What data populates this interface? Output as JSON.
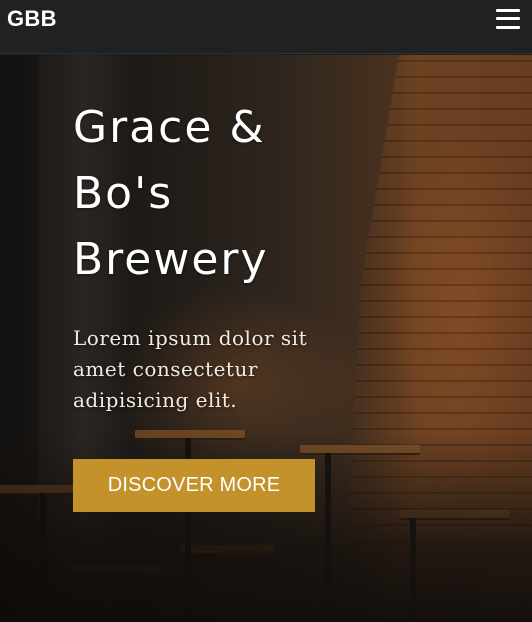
{
  "navbar": {
    "brand": "GBB",
    "menu_icon": "hamburger-menu-icon"
  },
  "hero": {
    "title_lines": [
      "Grace &",
      "Bo's",
      "Brewery"
    ],
    "lead": "Lorem ipsum dolor sit amet consectetur adipisicing elit.",
    "cta_label": "DISCOVER MORE",
    "background_image": "brewery-bar-interior",
    "colors": {
      "cta_background": "#c4922b",
      "navbar_background": "#1f2122",
      "text": "#ffffff"
    }
  }
}
